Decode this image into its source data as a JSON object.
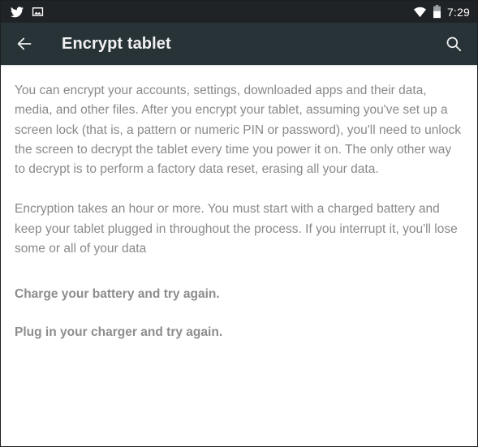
{
  "status_bar": {
    "left_icons": [
      {
        "name": "twitter-icon",
        "label": "Twitter notification"
      },
      {
        "name": "image-icon",
        "label": "Screenshot captured"
      }
    ],
    "right_icons": [
      {
        "name": "wifi-icon",
        "label": "Wi-Fi connected"
      },
      {
        "name": "battery-icon",
        "label": "Battery"
      }
    ],
    "time": "7:29",
    "background_color": "#1f2326"
  },
  "toolbar": {
    "back_label": "Navigate up",
    "title": "Encrypt tablet",
    "search_label": "Search",
    "background_color": "#283338",
    "title_color": "#f2f2f2"
  },
  "content": {
    "paragraph_1": "You can encrypt your accounts, settings, downloaded apps and their data, media, and other files. After you encrypt your tablet, assuming you've set up a screen lock (that is, a pattern or numeric PIN or password), you'll need to unlock the screen to decrypt the tablet every time you power it on. The only other way to decrypt is to perform a factory data reset, erasing all your data.",
    "paragraph_2": "Encryption takes an hour or more. You must start with a charged battery and keep your tablet plugged in throughout the process. If you interrupt it, you'll lose some or all of your data",
    "warning_1": "Charge your battery and try again.",
    "warning_2": "Plug in your charger and try again.",
    "text_color": "#898989",
    "background_color": "#ffffff"
  }
}
